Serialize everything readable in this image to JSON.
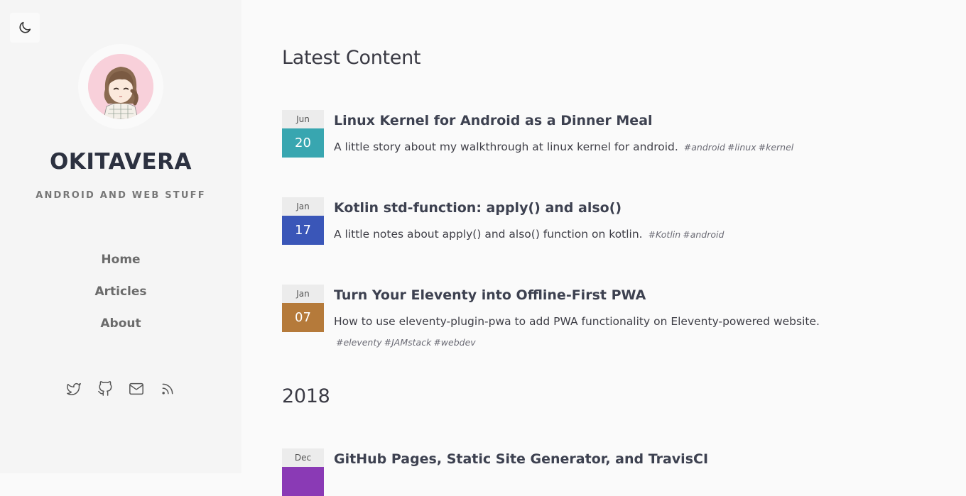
{
  "sidebar": {
    "site_title": "OKITAVERA",
    "site_subtitle": "ANDROID AND WEB STUFF",
    "nav": [
      {
        "label": "Home"
      },
      {
        "label": "Articles"
      },
      {
        "label": "About"
      }
    ],
    "social_icons": [
      "twitter-icon",
      "github-icon",
      "mail-icon",
      "rss-icon"
    ],
    "theme_toggle_icon": "moon-icon"
  },
  "main": {
    "heading": "Latest Content",
    "year_heading": "2018",
    "posts": [
      {
        "month": "Jun",
        "day": "20",
        "color": "#38a6b0",
        "title": "Linux Kernel for Android as a Dinner Meal",
        "description": "A little story about my walkthrough at linux kernel for android.",
        "tags": [
          "#android",
          "#linux",
          "#kernel"
        ]
      },
      {
        "month": "Jan",
        "day": "17",
        "color": "#3a56b8",
        "title": "Kotlin std-function: apply() and also()",
        "description": "A little notes about apply() and also() function on kotlin.",
        "tags": [
          "#Kotlin",
          "#android"
        ]
      },
      {
        "month": "Jan",
        "day": "07",
        "color": "#b57a3a",
        "title": "Turn Your Eleventy into Offline-First PWA",
        "description": "How to use eleventy-plugin-pwa to add PWA functionality on Eleventy-powered website.",
        "tags": [
          "#eleventy",
          "#JAMstack",
          "#webdev"
        ]
      },
      {
        "month": "Dec",
        "day": "",
        "color": "#8a3ab5",
        "title": "GitHub Pages, Static Site Generator, and TravisCI",
        "description": "",
        "tags": []
      }
    ]
  }
}
